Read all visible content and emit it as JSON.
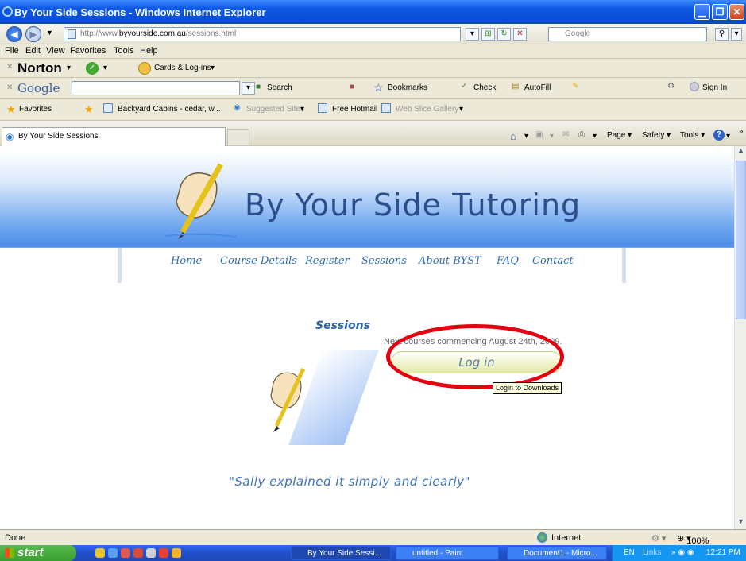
{
  "window": {
    "title": "By Your Side Sessions - Windows Internet Explorer"
  },
  "address_bar": {
    "url_prefix": "http://www.",
    "url_domain": "byyourside.com.au",
    "url_path": "/sessions.html",
    "search_placeholder": "Google"
  },
  "menu": [
    "File",
    "Edit",
    "View",
    "Favorites",
    "Tools",
    "Help"
  ],
  "norton_bar": {
    "brand": "Norton",
    "cards_label": "Cards & Log-ins"
  },
  "google_bar": {
    "brand": "Google",
    "search_label": "Search",
    "bookmarks_label": "Bookmarks",
    "check_label": "Check",
    "autofill_label": "AutoFill",
    "signin_label": "Sign In"
  },
  "favorites_bar": {
    "favorites_label": "Favorites",
    "items": [
      "Backyard Cabins - cedar, w...",
      "Suggested Sites",
      "Free Hotmail",
      "Web Slice Gallery"
    ]
  },
  "tab": {
    "label": "By Your Side Sessions"
  },
  "command_bar": {
    "page_label": "Page",
    "safety_label": "Safety",
    "tools_label": "Tools"
  },
  "page": {
    "site_title": "By Your Side Tutoring",
    "nav": [
      "Home",
      "Course Details",
      "Register",
      "Sessions",
      "About BYST",
      "FAQ",
      "Contact"
    ],
    "heading": "Sessions",
    "next_courses": "Next courses commencing August 24th, 2009.",
    "login_label": "Log in",
    "tooltip": "Login to Downloads",
    "quote": "\"Sally explained it simply and clearly\""
  },
  "status_bar": {
    "status": "Done",
    "zone": "Internet",
    "zoom": "100%"
  },
  "taskbar": {
    "start_label": "start",
    "tasks": [
      "By Your Side Sessi...",
      "untitled - Paint",
      "Document1 - Micro..."
    ],
    "tray_lang": "EN",
    "tray_links": "Links",
    "clock": "12:21 PM"
  },
  "colors": {
    "highlight_circle": "#e4000e",
    "title_blue": "#2c4e8d",
    "nav_blue": "#2e6cb4"
  }
}
